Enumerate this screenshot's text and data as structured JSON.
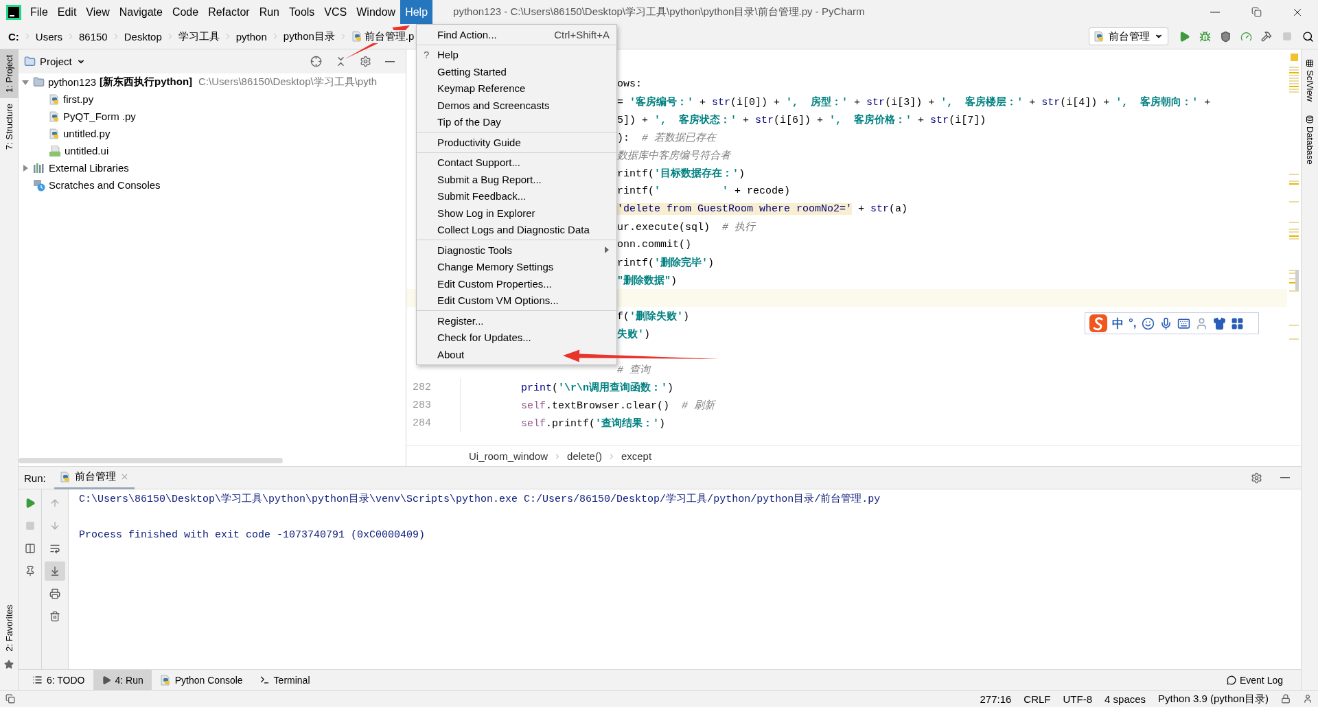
{
  "window": {
    "title": "python123 - C:\\Users\\86150\\Desktop\\学习工具\\python\\python目录\\前台管理.py - PyCharm"
  },
  "menu_bar": [
    {
      "label": "File",
      "selected": false
    },
    {
      "label": "Edit",
      "selected": false
    },
    {
      "label": "View",
      "selected": false
    },
    {
      "label": "Navigate",
      "selected": false
    },
    {
      "label": "Code",
      "selected": false
    },
    {
      "label": "Refactor",
      "selected": false
    },
    {
      "label": "Run",
      "selected": false
    },
    {
      "label": "Tools",
      "selected": false
    },
    {
      "label": "VCS",
      "selected": false
    },
    {
      "label": "Window",
      "selected": false
    },
    {
      "label": "Help",
      "selected": true
    }
  ],
  "breadcrumbs": [
    {
      "label": "C:",
      "kind": "drive"
    },
    {
      "label": "Users",
      "kind": "folder"
    },
    {
      "label": "86150",
      "kind": "folder"
    },
    {
      "label": "Desktop",
      "kind": "folder"
    },
    {
      "label": "学习工具",
      "kind": "folder"
    },
    {
      "label": "python",
      "kind": "folder"
    },
    {
      "label": "python目录",
      "kind": "folder"
    },
    {
      "label": "前台管理.p",
      "kind": "file"
    }
  ],
  "run_config": {
    "label": "前台管理"
  },
  "left_tool_strip": [
    {
      "label": "1: Project",
      "selected": true
    },
    {
      "label": "7: Structure",
      "selected": false
    }
  ],
  "favorites_tab": {
    "label": "2: Favorites"
  },
  "project_panel": {
    "title": "Project",
    "tree": [
      {
        "label": "python123",
        "note": "[新东西执行python]",
        "path": "C:\\Users\\86150\\Desktop\\学习工具\\pyth",
        "kind": "folder",
        "expanded": true,
        "children": [
          {
            "label": "first.py",
            "kind": "python"
          },
          {
            "label": "PyQT_Form .py",
            "kind": "python"
          },
          {
            "label": "untitled.py",
            "kind": "python"
          },
          {
            "label": "untitled.ui",
            "kind": "ui"
          }
        ]
      },
      {
        "label": "External Libraries",
        "kind": "library",
        "expanded": false
      },
      {
        "label": "Scratches and Consoles",
        "kind": "scratches"
      }
    ]
  },
  "editor": {
    "lines": [
      {
        "current": false,
        "tokens": [
          {
            "text": "ows:",
            "kind": "plain"
          }
        ]
      },
      {
        "current": false,
        "tokens": [
          {
            "text": "= ",
            "kind": "plain"
          },
          {
            "text": "'客房编号：'",
            "kind": "string"
          },
          {
            "text": " + ",
            "kind": "plain"
          },
          {
            "text": "str",
            "kind": "builtin"
          },
          {
            "text": "(i[0]) + ",
            "kind": "plain"
          },
          {
            "text": "',  房型：'",
            "kind": "string"
          },
          {
            "text": " + ",
            "kind": "plain"
          },
          {
            "text": "str",
            "kind": "builtin"
          },
          {
            "text": "(i[3]) + ",
            "kind": "plain"
          },
          {
            "text": "',  客房楼层：'",
            "kind": "string"
          },
          {
            "text": " + ",
            "kind": "plain"
          },
          {
            "text": "str",
            "kind": "builtin"
          },
          {
            "text": "(i[4]) + ",
            "kind": "plain"
          },
          {
            "text": "',  客房朝向：'",
            "kind": "string"
          },
          {
            "text": " +",
            "kind": "plain"
          }
        ]
      },
      {
        "current": false,
        "tokens": [
          {
            "text": "5]) + ",
            "kind": "plain"
          },
          {
            "text": "',  客房状态：'",
            "kind": "string"
          },
          {
            "text": " + ",
            "kind": "plain"
          },
          {
            "text": "str",
            "kind": "builtin"
          },
          {
            "text": "(i[6]) + ",
            "kind": "plain"
          },
          {
            "text": "',  客房价格：'",
            "kind": "string"
          },
          {
            "text": " + ",
            "kind": "plain"
          },
          {
            "text": "str",
            "kind": "builtin"
          },
          {
            "text": "(i[7])",
            "kind": "plain"
          }
        ]
      },
      {
        "current": false,
        "tokens": [
          {
            "text": "):  ",
            "kind": "plain"
          },
          {
            "text": "# 若数据已存在",
            "kind": "comment"
          }
        ]
      },
      {
        "current": false,
        "tokens": [
          {
            "text": "数据库中客房编号符合者",
            "kind": "comment"
          }
        ]
      },
      {
        "current": false,
        "tokens": [
          {
            "text": "rintf(",
            "kind": "plain"
          },
          {
            "text": "'目标数据存在：'",
            "kind": "string"
          },
          {
            "text": ")",
            "kind": "plain"
          }
        ]
      },
      {
        "current": false,
        "tokens": [
          {
            "text": "rintf(",
            "kind": "plain"
          },
          {
            "text": "'          '",
            "kind": "string"
          },
          {
            "text": " + recode)",
            "kind": "plain"
          }
        ]
      },
      {
        "current": false,
        "tokens": [
          {
            "text": "'delete from GuestRoom where roomNo2='",
            "kind": "sql"
          },
          {
            "text": " + ",
            "kind": "plain"
          },
          {
            "text": "str",
            "kind": "builtin"
          },
          {
            "text": "(a)",
            "kind": "plain"
          }
        ]
      },
      {
        "current": false,
        "tokens": [
          {
            "text": "ur.execute(sql)  ",
            "kind": "plain"
          },
          {
            "text": "# 执行",
            "kind": "comment"
          }
        ]
      },
      {
        "current": false,
        "tokens": [
          {
            "text": "onn.commit()",
            "kind": "plain"
          }
        ]
      },
      {
        "current": false,
        "tokens": [
          {
            "text": "rintf(",
            "kind": "plain"
          },
          {
            "text": "'删除完毕'",
            "kind": "string"
          },
          {
            "text": ")",
            "kind": "plain"
          }
        ]
      },
      {
        "current": false,
        "tokens": [
          {
            "text": "\"删除数据\"",
            "kind": "string"
          },
          {
            "text": ")",
            "kind": "plain"
          }
        ]
      },
      {
        "current": true
      },
      {
        "current": false,
        "tokens": [
          {
            "text": "f(",
            "kind": "plain"
          },
          {
            "text": "'删除失败'",
            "kind": "string"
          },
          {
            "text": ")",
            "kind": "plain"
          }
        ]
      },
      {
        "current": false,
        "tokens": [
          {
            "text": "失败'",
            "kind": "string"
          },
          {
            "text": ")",
            "kind": "plain"
          }
        ]
      },
      {
        "current": false
      },
      {
        "current": false,
        "tokens": [
          {
            "text": "# 查询",
            "kind": "comment"
          }
        ]
      },
      {
        "number": "282",
        "current": false,
        "tokens": [
          {
            "text": "print",
            "kind": "builtin"
          },
          {
            "text": "(",
            "kind": "plain"
          },
          {
            "text": "'\\r\\n调用查询函数：'",
            "kind": "string"
          },
          {
            "text": ")",
            "kind": "plain"
          }
        ]
      },
      {
        "number": "283",
        "current": false,
        "tokens": [
          {
            "text": "self",
            "kind": "self"
          },
          {
            "text": ".textBrowser.clear()  ",
            "kind": "plain"
          },
          {
            "text": "# 刷新",
            "kind": "comment"
          }
        ]
      },
      {
        "number": "284",
        "current": false,
        "tokens": [
          {
            "text": "self",
            "kind": "self"
          },
          {
            "text": ".printf(",
            "kind": "plain"
          },
          {
            "text": "'查询结果：'",
            "kind": "string"
          },
          {
            "text": ")",
            "kind": "plain"
          }
        ]
      }
    ],
    "breadcrumb": [
      "Ui_room_window",
      "delete()",
      "except"
    ]
  },
  "right_tool_strip": [
    "SciView",
    "Database"
  ],
  "help_menu": {
    "groups": [
      [
        {
          "label": "Find Action...",
          "shortcut": "Ctrl+Shift+A",
          "kind": "action"
        }
      ],
      [
        {
          "label": "Help",
          "icon": "?",
          "kind": "action"
        },
        {
          "label": "Getting Started",
          "kind": "action"
        },
        {
          "label": "Keymap Reference",
          "kind": "action"
        },
        {
          "label": "Demos and Screencasts",
          "kind": "action"
        },
        {
          "label": "Tip of the Day",
          "kind": "action"
        }
      ],
      [
        {
          "label": "Productivity Guide",
          "kind": "action"
        }
      ],
      [
        {
          "label": "Contact Support...",
          "kind": "action"
        },
        {
          "label": "Submit a Bug Report...",
          "kind": "action"
        },
        {
          "label": "Submit Feedback...",
          "kind": "action"
        },
        {
          "label": "Show Log in Explorer",
          "kind": "action"
        },
        {
          "label": "Collect Logs and Diagnostic Data",
          "kind": "action"
        }
      ],
      [
        {
          "label": "Diagnostic Tools",
          "kind": "submenu"
        },
        {
          "label": "Change Memory Settings",
          "kind": "action"
        },
        {
          "label": "Edit Custom Properties...",
          "kind": "action"
        },
        {
          "label": "Edit Custom VM Options...",
          "kind": "action"
        }
      ],
      [
        {
          "label": "Register...",
          "kind": "action"
        },
        {
          "label": "Check for Updates...",
          "kind": "action"
        },
        {
          "label": "About",
          "kind": "action"
        }
      ]
    ]
  },
  "ime_toolbar": {
    "texts": [
      "中",
      "°,"
    ]
  },
  "run_panel": {
    "title": "Run:",
    "tab": "前台管理",
    "scroll_to_end": true,
    "soft_wrap": false,
    "output": [
      "C:\\Users\\86150\\Desktop\\学习工具\\python\\python目录\\venv\\Scripts\\python.exe C:/Users/86150/Desktop/学习工具/python/python目录/前台管理.py",
      "Process finished with exit code -1073740791 (0xC0000409)"
    ]
  },
  "bottom_tabs": [
    {
      "label": "6: TODO",
      "kind": "todo",
      "selected": false
    },
    {
      "label": "4: Run",
      "kind": "run",
      "selected": true
    },
    {
      "label": "Python Console",
      "kind": "console",
      "selected": false
    },
    {
      "label": "Terminal",
      "kind": "terminal",
      "selected": false
    }
  ],
  "event_log": "Event Log",
  "status_bar": [
    "277:16",
    "CRLF",
    "UTF-8",
    "4 spaces",
    "Python 3.9 (python目录)"
  ],
  "annotations": [
    {
      "kind": "arrow"
    },
    {
      "kind": "arrow"
    }
  ]
}
